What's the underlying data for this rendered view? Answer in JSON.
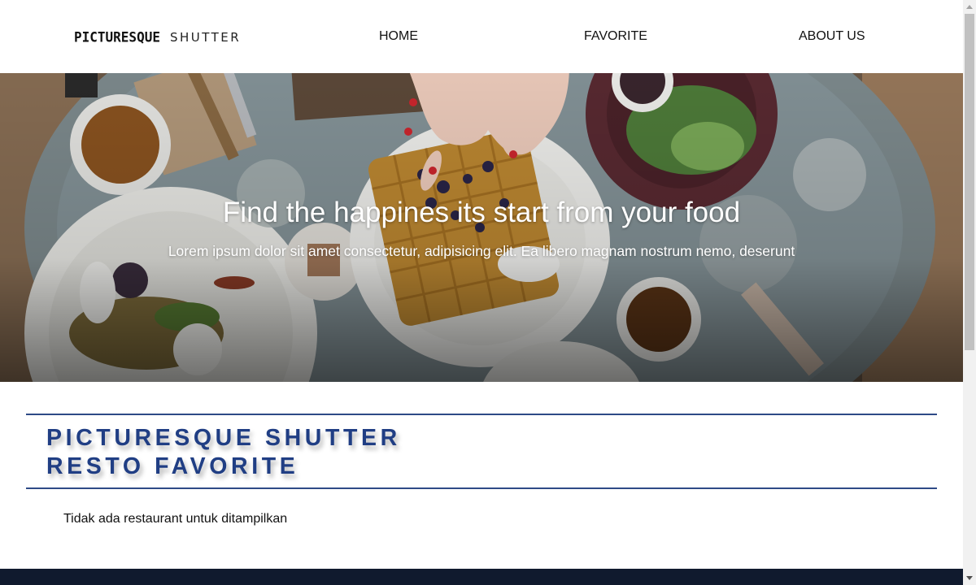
{
  "header": {
    "logo_bold": "PICTURESQUE",
    "logo_light": "SHUTTER",
    "nav": [
      {
        "label": "HOME"
      },
      {
        "label": "FAVORITE"
      },
      {
        "label": "ABOUT US"
      }
    ]
  },
  "hero": {
    "title": "Find the happines its start from your food",
    "subtitle": "Lorem ipsum dolor sit amet consectetur, adipisicing elit. Ea libero magnam nostrum nemo, deserunt"
  },
  "section": {
    "title_line1": "PICTURESQUE SHUTTER",
    "title_line2": "RESTO FAVORITE",
    "empty_message": "Tidak ada restaurant untuk ditampilkan"
  },
  "colors": {
    "accent": "#2e4a86",
    "title": "#203e84",
    "footer": "#101a2e"
  }
}
